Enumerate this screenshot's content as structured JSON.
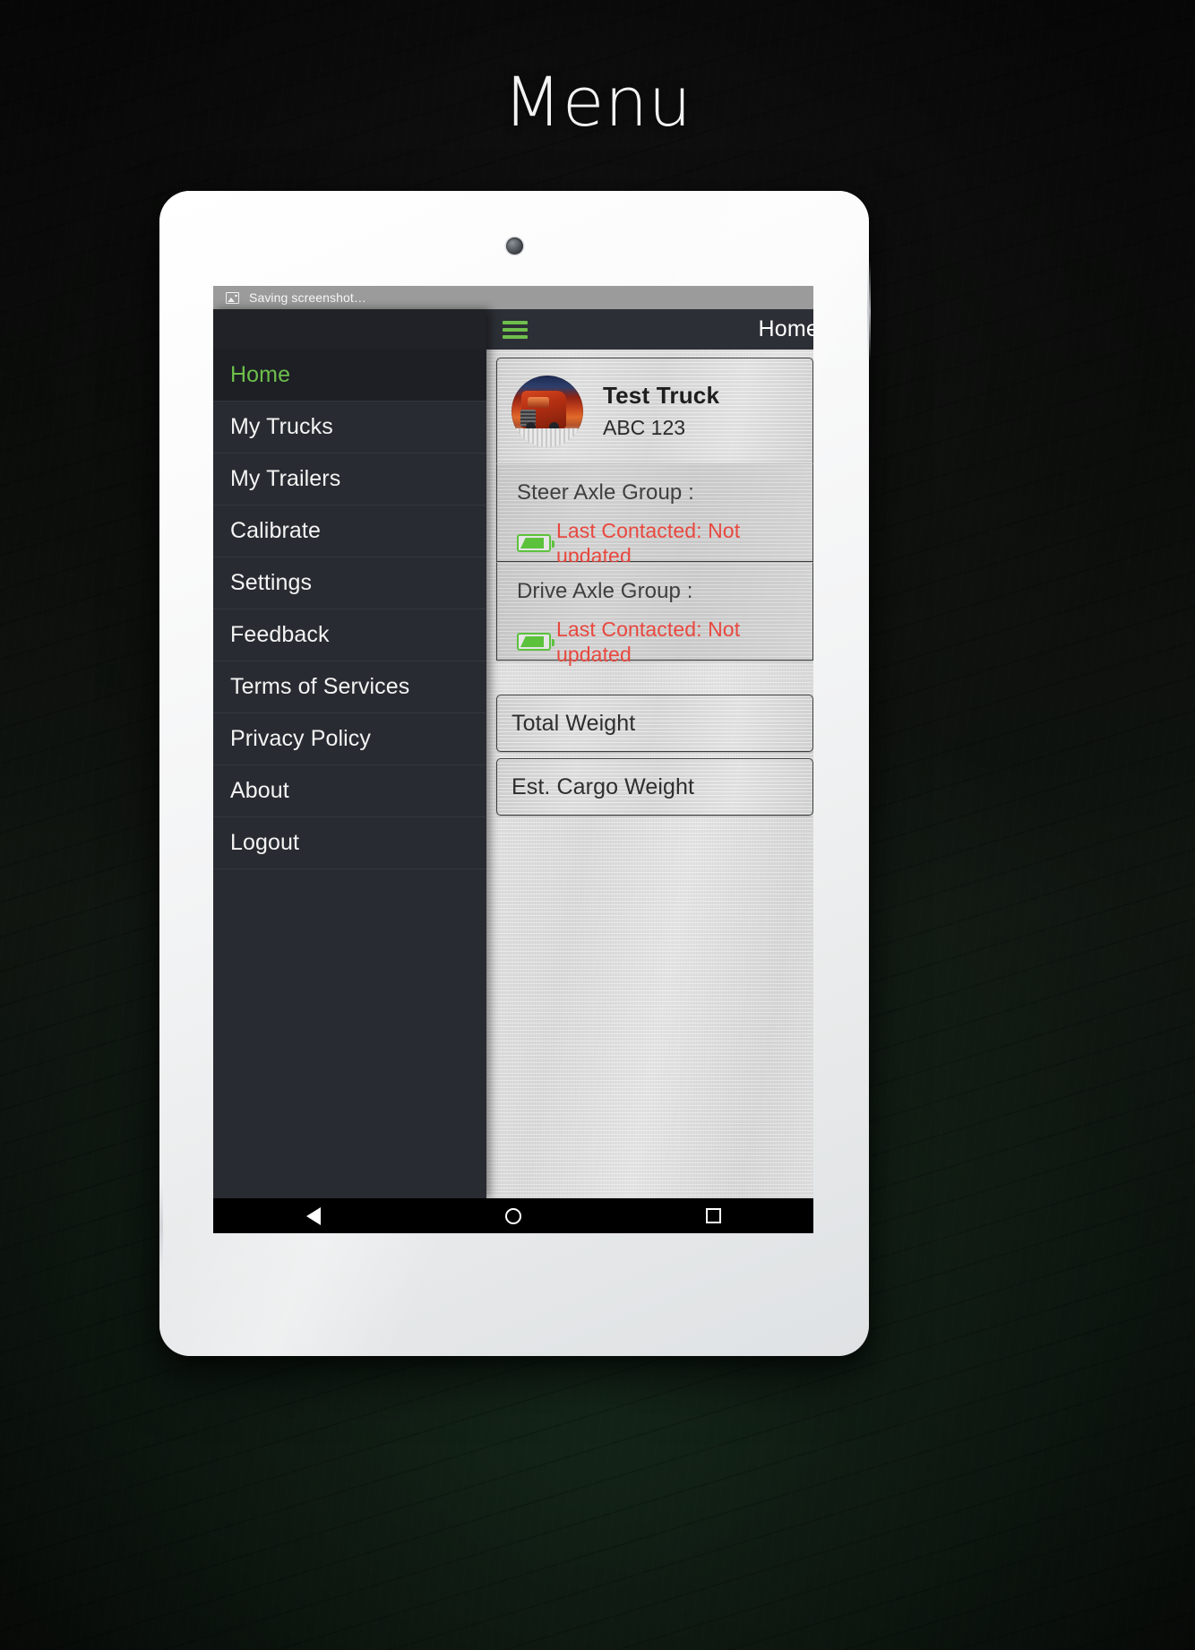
{
  "page": {
    "title": "Menu"
  },
  "status_bar": {
    "text": "Saving screenshot…",
    "icon": "image-icon"
  },
  "toolbar": {
    "menu_icon": "hamburger-menu-icon",
    "title": "Home",
    "accent_color": "#6fbf4d"
  },
  "drawer": {
    "items": [
      {
        "label": "Home",
        "selected": true
      },
      {
        "label": "My Trucks",
        "selected": false
      },
      {
        "label": "My Trailers",
        "selected": false
      },
      {
        "label": "Calibrate",
        "selected": false
      },
      {
        "label": "Settings",
        "selected": false
      },
      {
        "label": "Feedback",
        "selected": false
      },
      {
        "label": "Terms of Services",
        "selected": false
      },
      {
        "label": "Privacy Policy",
        "selected": false
      },
      {
        "label": "About",
        "selected": false
      },
      {
        "label": "Logout",
        "selected": false
      }
    ],
    "selected_color": "#6dbf4b",
    "text_color": "#f4f4f4",
    "background_color": "#282b31"
  },
  "truck": {
    "name": "Test Truck",
    "plate": "ABC 123",
    "avatar": "truck-photo-icon"
  },
  "axle_groups": [
    {
      "title": "Steer Axle Group :",
      "battery_icon": "battery-icon",
      "status": "Last Contacted: Not updated",
      "status_color": "#e8483f"
    },
    {
      "title": "Drive Axle Group :",
      "battery_icon": "battery-icon",
      "status": "Last Contacted: Not updated",
      "status_color": "#e8483f"
    }
  ],
  "weights": [
    {
      "label": "Total Weight"
    },
    {
      "label": "Est. Cargo Weight"
    }
  ],
  "navbar": {
    "back": "back-triangle-icon",
    "home": "home-circle-icon",
    "recents": "recents-square-icon"
  }
}
